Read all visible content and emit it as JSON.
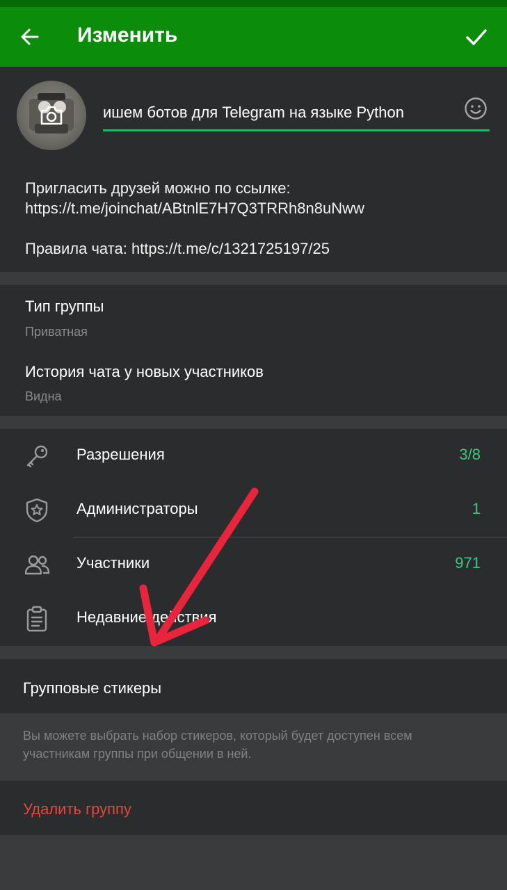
{
  "header": {
    "title": "Изменить",
    "back_icon": "arrow-left-icon",
    "done_icon": "checkmark-icon"
  },
  "profile": {
    "group_name": "ишем ботов для Telegram на языке Python",
    "camera_icon": "camera-icon",
    "emoji_icon": "smiley-icon"
  },
  "description": {
    "line1": "Пригласить друзей можно по ссылке:",
    "line2": "https://t.me/joinchat/ABtnlE7H7Q3TRRh8n8uNww",
    "line3": "Правила чата: https://t.me/c/1321725197/25"
  },
  "settings": {
    "group_type_label": "Тип группы",
    "group_type_value": "Приватная",
    "history_label": "История чата у новых участников",
    "history_value": "Видна"
  },
  "menu": [
    {
      "label": "Разрешения",
      "value": "3/8",
      "icon": "key-icon"
    },
    {
      "label": "Администраторы",
      "value": "1",
      "icon": "shield-star-icon"
    },
    {
      "label": "Участники",
      "value": "971",
      "icon": "people-icon"
    },
    {
      "label": "Недавние действия",
      "value": "",
      "icon": "clipboard-icon"
    }
  ],
  "stickers": {
    "title": "Групповые стикеры",
    "hint": "Вы можете выбрать набор стикеров, который будет доступен всем участникам группы при общении в ней."
  },
  "danger": {
    "delete_label": "Удалить группу"
  },
  "colors": {
    "appbar": "#0b8c0b",
    "accent": "#3bc981",
    "danger": "#e4473c",
    "annotation_arrow": "#e8253d"
  }
}
